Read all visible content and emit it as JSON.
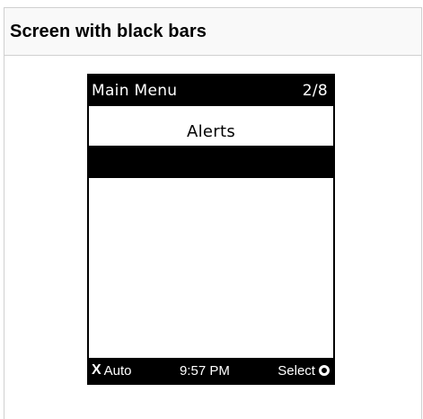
{
  "card": {
    "title": "Screen with black bars"
  },
  "screen": {
    "top_bar": {
      "title": "Main Menu",
      "page_indicator": "2/8"
    },
    "menu_item": "Alerts",
    "bottom_bar": {
      "left_icon": "x-icon",
      "left_icon_glyph": "X",
      "left_label": "Auto",
      "time": "9:57 PM",
      "right_label": "Select",
      "right_icon": "select-circle-icon"
    }
  }
}
